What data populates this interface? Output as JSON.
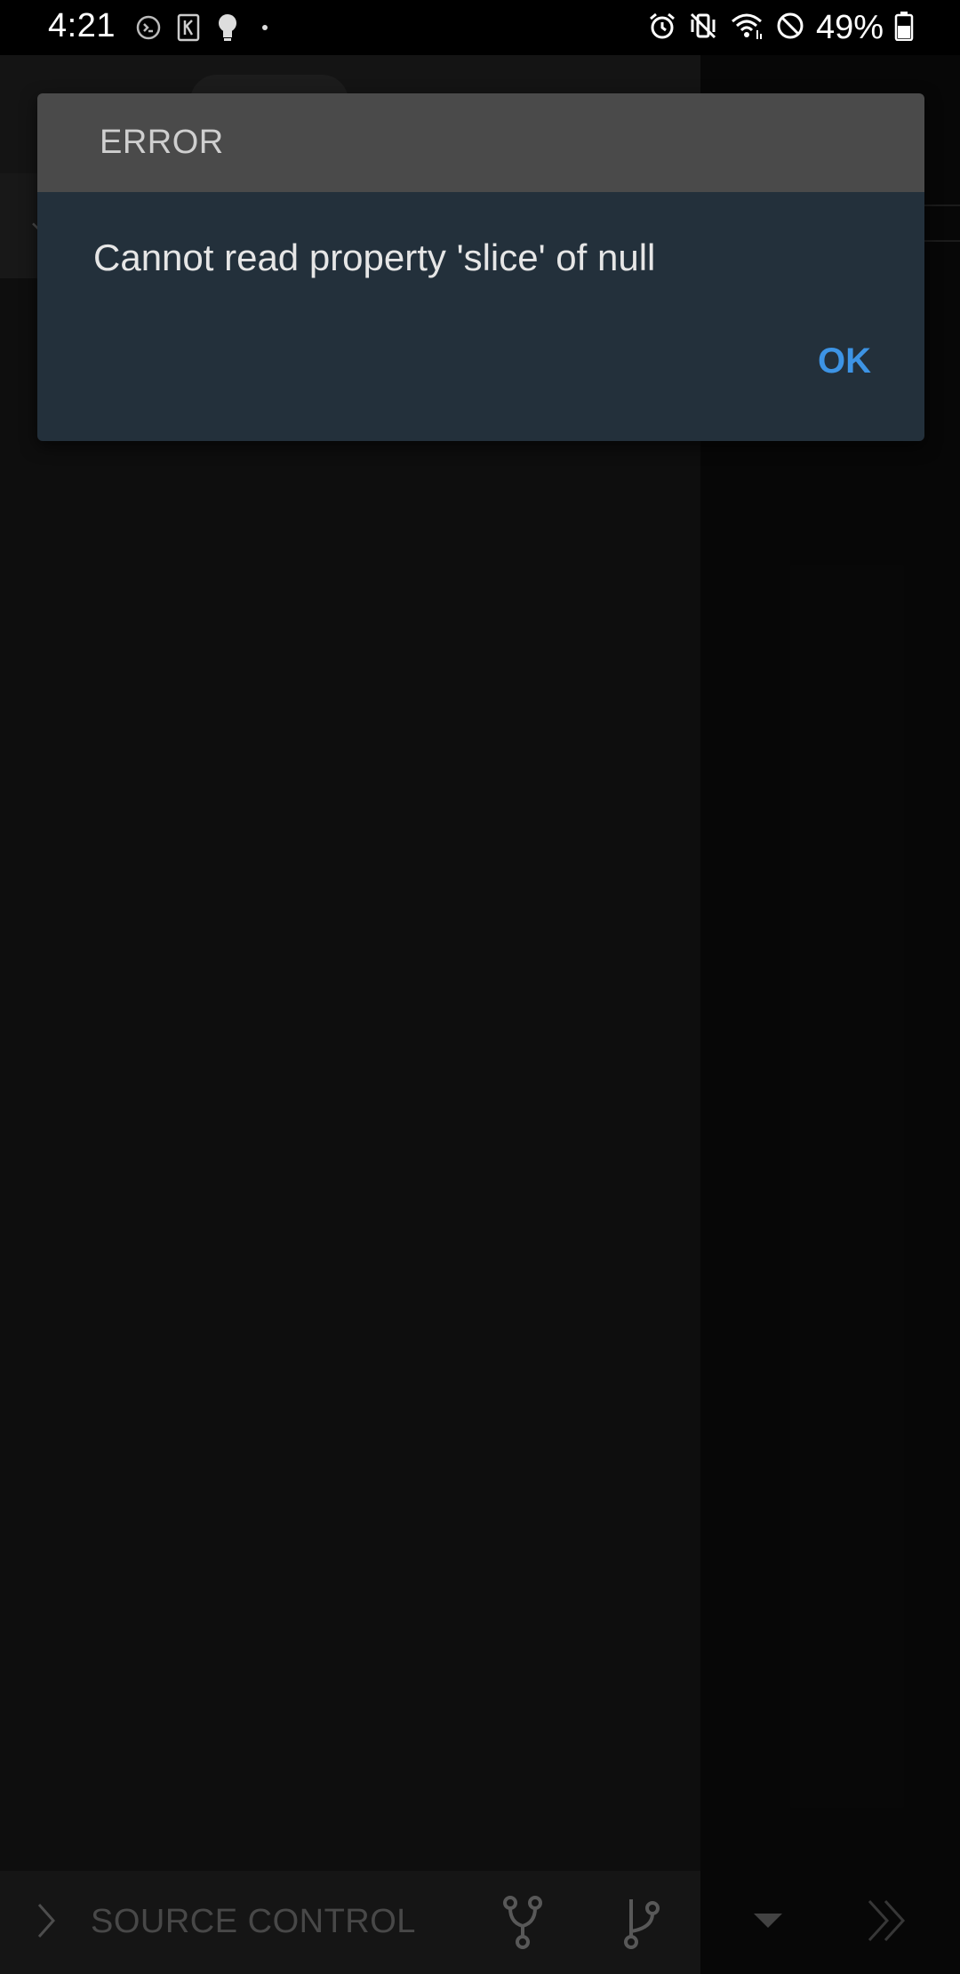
{
  "status_bar": {
    "time": "4:21",
    "notification_icons": [
      "terminal-icon",
      "kindle-icon",
      "bulb-icon",
      "dot-icon"
    ],
    "system_icons": [
      "alarm-icon",
      "vibrate-icon",
      "wifi-icon",
      "do-not-disturb-icon",
      "battery-icon"
    ],
    "battery": "49%"
  },
  "dialog": {
    "title": "ERROR",
    "message": "Cannot read property 'slice' of null",
    "ok_label": "OK"
  },
  "bottom_bar": {
    "title": "SOURCE CONTROL",
    "icons": [
      "chevron-right-icon",
      "fork-icon",
      "branch-icon",
      "dropdown-arrow-icon",
      "double-chevron-right-icon"
    ]
  },
  "colors": {
    "accent": "#3d94e5",
    "dialog_title_bg": "#4a4a4a",
    "dialog_body_bg": "#23303b",
    "panel_bg": "#161616"
  }
}
